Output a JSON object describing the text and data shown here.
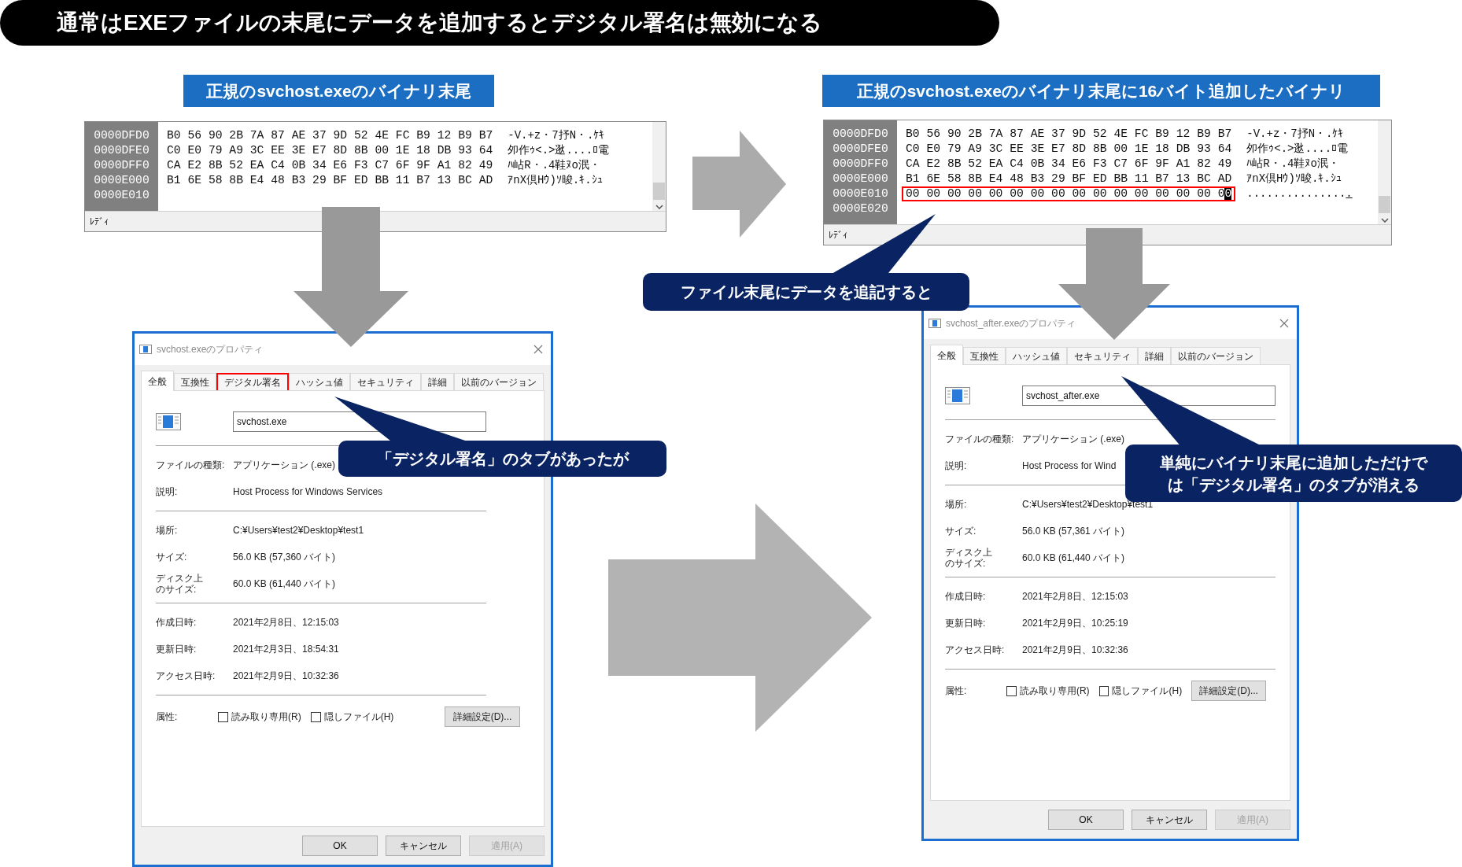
{
  "title": "通常はEXEファイルの末尾にデータを追加するとデジタル署名は無効になる",
  "panels": [
    {
      "label": "正規のsvchost.exeのバイナリ末尾",
      "hex_view": {
        "rows": [
          {
            "offset": "0000DFD0",
            "bytes": "B0 56 90 2B 7A 87 AE 37 9D 52 4E FC B9 12 B9 B7",
            "text": "-V.+z・7抒N・.ｹｷ",
            "outlined": false,
            "cursor": false
          },
          {
            "offset": "0000DFE0",
            "bytes": "C0 E0 79 A9 3C EE 3E E7 8D 8B 00 1E 18 DB 93 64",
            "text": "夘作ｩ<.>逖....ﾛ電",
            "outlined": false,
            "cursor": false
          },
          {
            "offset": "0000DFF0",
            "bytes": "CA E2 8B 52 EA C4 0B 34 E6 F3 C7 6F 9F A1 82 49",
            "text": "ﾊ岾R・.4鞋ﾇo泯・",
            "outlined": false,
            "cursor": false
          },
          {
            "offset": "0000E000",
            "bytes": "B1 6E 58 8B E4 48 B3 29 BF ED BB 11 B7 13 BC AD",
            "text": "ｱnX倶Hｳ)ｿ晙.ｷ.ｼｭ",
            "outlined": false,
            "cursor": false
          },
          {
            "offset": "0000E010"
          }
        ],
        "status": "ﾚﾃﾞｨ"
      },
      "dialog": {
        "title": "svchost.exeのプロパティ",
        "tabs": [
          {
            "label": "全般",
            "selected": true,
            "outlined": false
          },
          {
            "label": "互換性",
            "selected": false,
            "outlined": false
          },
          {
            "label": "デジタル署名",
            "selected": false,
            "outlined": true
          },
          {
            "label": "ハッシュ値",
            "selected": false,
            "outlined": false
          },
          {
            "label": "セキュリティ",
            "selected": false,
            "outlined": false
          },
          {
            "label": "詳細",
            "selected": false,
            "outlined": false
          },
          {
            "label": "以前のバージョン",
            "selected": false,
            "outlined": false
          }
        ],
        "file_name": "svchost.exe",
        "sections": [
          [
            {
              "label": "ファイルの種類:",
              "value": "アプリケーション (.exe)"
            },
            {
              "label": "説明:",
              "value": "Host Process for Windows Services"
            }
          ],
          [
            {
              "label": "場所:",
              "value": "C:¥Users¥test2¥Desktop¥test1"
            },
            {
              "label": "サイズ:",
              "value": "56.0 KB (57,360 バイト)"
            },
            {
              "label_lines": [
                "ディスク上",
                "のサイズ:"
              ],
              "value": "60.0 KB (61,440 バイト)"
            }
          ],
          [
            {
              "label": "作成日時:",
              "value": "2021年2月8日、12:15:03"
            },
            {
              "label": "更新日時:",
              "value": "2021年2月3日、18:54:31"
            },
            {
              "label": "アクセス日時:",
              "value": "2021年2月9日、10:32:36"
            }
          ]
        ],
        "attributes": {
          "label": "属性:",
          "checkboxes": [
            {
              "label": "読み取り専用(R)",
              "checked": false
            },
            {
              "label": "隠しファイル(H)",
              "checked": false
            }
          ],
          "button": "詳細設定(D)..."
        },
        "buttons": [
          {
            "label": "OK",
            "disabled": false
          },
          {
            "label": "キャンセル",
            "disabled": false
          },
          {
            "label": "適用(A)",
            "disabled": true
          }
        ]
      }
    },
    {
      "label": "正規のsvchost.exeのバイナリ末尾に16バイト追加したバイナリ",
      "hex_view": {
        "rows": [
          {
            "offset": "0000DFD0",
            "bytes": "B0 56 90 2B 7A 87 AE 37 9D 52 4E FC B9 12 B9 B7",
            "text": "-V.+z・7抒N・.ｹｷ",
            "outlined": false,
            "cursor": false
          },
          {
            "offset": "0000DFE0",
            "bytes": "C0 E0 79 A9 3C EE 3E E7 8D 8B 00 1E 18 DB 93 64",
            "text": "夘作ｩ<.>逖....ﾛ電",
            "outlined": false,
            "cursor": false
          },
          {
            "offset": "0000DFF0",
            "bytes": "CA E2 8B 52 EA C4 0B 34 E6 F3 C7 6F 9F A1 82 49",
            "text": "ﾊ岾R・.4鞋ﾇo泯・",
            "outlined": false,
            "cursor": false
          },
          {
            "offset": "0000E000",
            "bytes": "B1 6E 58 8B E4 48 B3 29 BF ED BB 11 B7 13 BC AD",
            "text": "ｱnX倶Hｳ)ｿ晙.ｷ.ｼｭ",
            "outlined": false,
            "cursor": false
          },
          {
            "offset": "0000E010",
            "bytes": "00 00 00 00 00 00 00 00 00 00 00 00 00 00 00 00",
            "text": "................",
            "outlined": true,
            "cursor": true
          },
          {
            "offset": "0000E020"
          }
        ],
        "status": "ﾚﾃﾞｨ"
      },
      "dialog": {
        "title": "svchost_after.exeのプロパティ",
        "tabs": [
          {
            "label": "全般",
            "selected": true,
            "outlined": false
          },
          {
            "label": "互換性",
            "selected": false,
            "outlined": false
          },
          {
            "label": "ハッシュ値",
            "selected": false,
            "outlined": false
          },
          {
            "label": "セキュリティ",
            "selected": false,
            "outlined": false
          },
          {
            "label": "詳細",
            "selected": false,
            "outlined": false
          },
          {
            "label": "以前のバージョン",
            "selected": false,
            "outlined": false
          }
        ],
        "file_name": "svchost_after.exe",
        "sections": [
          [
            {
              "label": "ファイルの種類:",
              "value": "アプリケーション (.exe)"
            },
            {
              "label": "説明:",
              "value": "Host Process for Wind"
            }
          ],
          [
            {
              "label": "場所:",
              "value": "C:¥Users¥test2¥Desktop¥test1"
            },
            {
              "label": "サイズ:",
              "value": "56.0 KB (57,361 バイト)"
            },
            {
              "label_lines": [
                "ディスク上",
                "のサイズ:"
              ],
              "value": "60.0 KB (61,440 バイト)"
            }
          ],
          [
            {
              "label": "作成日時:",
              "value": "2021年2月8日、12:15:03"
            },
            {
              "label": "更新日時:",
              "value": "2021年2月9日、10:25:19"
            },
            {
              "label": "アクセス日時:",
              "value": "2021年2月9日、10:32:36"
            }
          ]
        ],
        "attributes": {
          "label": "属性:",
          "checkboxes": [
            {
              "label": "読み取り専用(R)",
              "checked": false
            },
            {
              "label": "隠しファイル(H)",
              "checked": false
            }
          ],
          "button": "詳細設定(D)..."
        },
        "buttons": [
          {
            "label": "OK",
            "disabled": false
          },
          {
            "label": "キャンセル",
            "disabled": false
          },
          {
            "label": "適用(A)",
            "disabled": true
          }
        ]
      }
    }
  ],
  "callouts": [
    {
      "lines": [
        "ファイル末尾にデータを追記すると"
      ]
    },
    {
      "lines": [
        "「デジタル署名」のタブがあったが"
      ]
    },
    {
      "lines": [
        "単純にバイナリ末尾に追加しただけで",
        "は「デジタル署名」のタブが消える"
      ]
    }
  ]
}
